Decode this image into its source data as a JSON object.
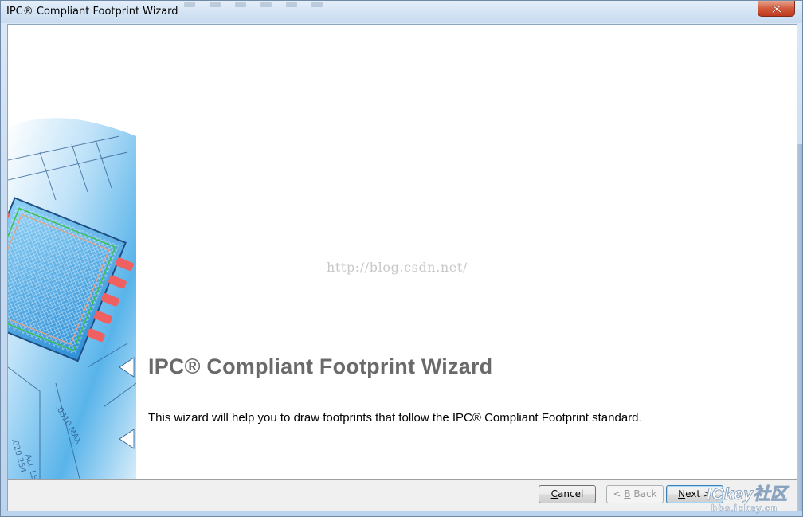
{
  "window": {
    "title": "IPC® Compliant Footprint Wizard"
  },
  "main": {
    "heading": "IPC® Compliant Footprint Wizard",
    "description": "This wizard will help you to draw footprints that follow the IPC® Compliant Footprint standard.",
    "watermark": "http://blog.csdn.net/"
  },
  "buttons": {
    "cancel_label": "ancel",
    "cancel_mnemonic": "C",
    "back_label": " Back",
    "back_prefix": "< ",
    "back_mnemonic": "B",
    "next_label": "ext >",
    "next_mnemonic": "N"
  },
  "overlay_logo": {
    "big": "ICkey社区",
    "small": "bbs.ickey.cn"
  },
  "colors": {
    "heading": "#6a6a6a",
    "close_button": "#c0391c",
    "art_blue": "#3f9fe0",
    "pad_red": "#f06060"
  },
  "icons": [
    "close-icon"
  ]
}
